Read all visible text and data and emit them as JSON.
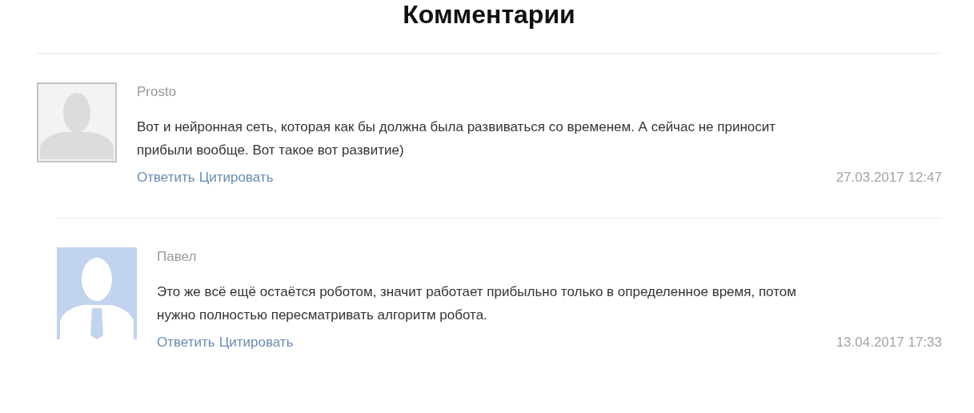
{
  "title": "Комментарии",
  "comments": [
    {
      "author": "Prosto",
      "avatar": {
        "kind": "generic"
      },
      "text": "Вот и нейронная сеть, которая как бы должна была развиваться со временем. А сейчас не приносит прибыли вообще. Вот такое вот развитие)",
      "actions": [
        "Ответить",
        "Цитировать"
      ],
      "date": "27.03.2017 12:47",
      "children": [
        {
          "author": "Павел",
          "avatar": {
            "kind": "suit"
          },
          "text": "Это же всё ещё остаётся роботом, значит работает прибыльно только в определенное время, потом нужно полностью пересматривать алгоритм робота.",
          "actions": [
            "Ответить",
            "Цитировать"
          ],
          "date": "13.04.2017 17:33"
        }
      ]
    }
  ]
}
